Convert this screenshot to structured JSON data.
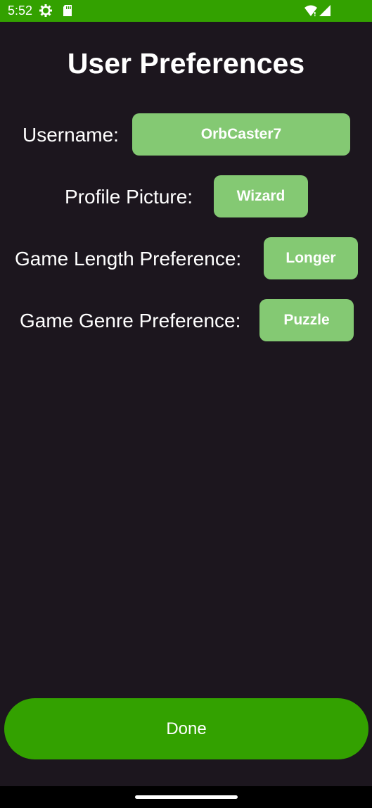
{
  "status_bar": {
    "time": "5:52",
    "icons": [
      "gear-icon",
      "sd-card-icon",
      "wifi-icon",
      "signal-icon"
    ]
  },
  "title": "User Preferences",
  "preferences": {
    "username": {
      "label": "Username:",
      "value": "OrbCaster7"
    },
    "profile_picture": {
      "label": "Profile Picture:",
      "value": "Wizard"
    },
    "game_length": {
      "label": "Game Length Preference:",
      "value": "Longer"
    },
    "game_genre": {
      "label": "Game Genre Preference:",
      "value": "Puzzle"
    }
  },
  "done_label": "Done",
  "colors": {
    "status_bar": "#33a100",
    "background": "#1c161e",
    "pref_button": "#84c973",
    "done_button": "#33a100"
  }
}
